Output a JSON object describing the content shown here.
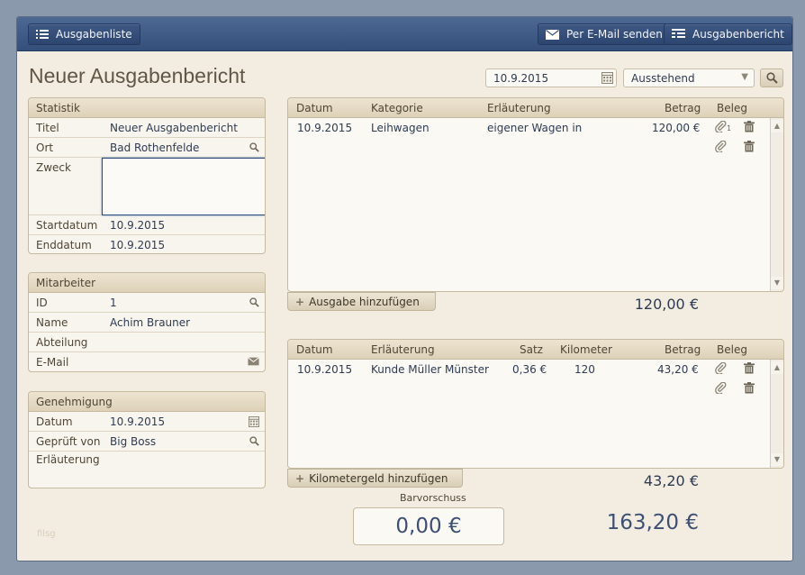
{
  "toolbar": {
    "list_label": "Ausgabenliste",
    "email_label": "Per E-Mail senden",
    "report_label": "Ausgabenbericht"
  },
  "header": {
    "title": "Neuer Ausgabenbericht",
    "date": "10.9.2015",
    "status": "Ausstehend"
  },
  "statistik": {
    "title": "Statistik",
    "rows": [
      {
        "label": "Titel",
        "value": "Neuer Ausgabenbericht"
      },
      {
        "label": "Ort",
        "value": "Bad Rothenfelde"
      },
      {
        "label": "Zweck",
        "value": ""
      },
      {
        "label": "Startdatum",
        "value": "10.9.2015"
      },
      {
        "label": "Enddatum",
        "value": "10.9.2015"
      }
    ]
  },
  "mitarbeiter": {
    "title": "Mitarbeiter",
    "rows": [
      {
        "label": "ID",
        "value": "1"
      },
      {
        "label": "Name",
        "value": "Achim Brauner"
      },
      {
        "label": "Abteilung",
        "value": ""
      },
      {
        "label": "E-Mail",
        "value": ""
      }
    ]
  },
  "genehmigung": {
    "title": "Genehmigung",
    "rows": [
      {
        "label": "Datum",
        "value": "10.9.2015"
      },
      {
        "label": "Geprüft von",
        "value": "Big Boss"
      },
      {
        "label": "Erläuterung",
        "value": ""
      }
    ]
  },
  "expenses": {
    "headers": {
      "datum": "Datum",
      "kategorie": "Kategorie",
      "erlaeuterung": "Erläuterung",
      "betrag": "Betrag",
      "beleg": "Beleg"
    },
    "rows": [
      {
        "datum": "10.9.2015",
        "kategorie": "Leihwagen",
        "erlaeuterung": "eigener Wagen in",
        "betrag": "120,00 €",
        "attach_count": "1"
      }
    ],
    "add_label": "Ausgabe hinzufügen",
    "sum": "120,00 €"
  },
  "mileage": {
    "headers": {
      "datum": "Datum",
      "erlaeuterung": "Erläuterung",
      "satz": "Satz",
      "kilometer": "Kilometer",
      "betrag": "Betrag",
      "beleg": "Beleg"
    },
    "rows": [
      {
        "datum": "10.9.2015",
        "erlaeuterung": "Kunde Müller Münster",
        "satz": "0,36 €",
        "kilometer": "120",
        "betrag": "43,20 €"
      }
    ],
    "add_label": "Kilometergeld hinzufügen",
    "sum": "43,20 €"
  },
  "footer": {
    "advance_label": "Barvorschuss",
    "advance_value": "0,00 €",
    "total": "163,20 €",
    "faint_text": "filsg"
  }
}
